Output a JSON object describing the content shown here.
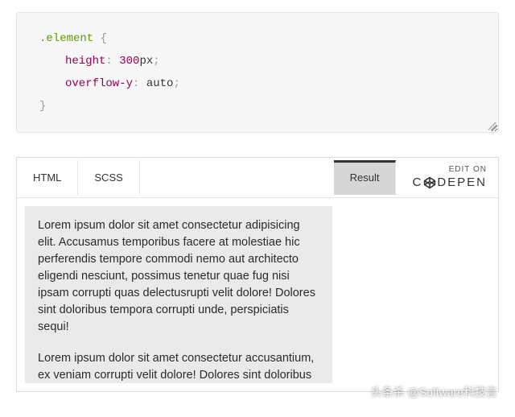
{
  "code": {
    "selector": ".element",
    "brace_open": " {",
    "brace_close": "}",
    "prop1_name": "height",
    "prop1_colon": ": ",
    "prop1_value": "300",
    "prop1_unit": "px",
    "semi": ";",
    "prop2_name": "overflow-y",
    "prop2_colon": ": ",
    "prop2_value": "auto"
  },
  "tabs": {
    "html": "HTML",
    "scss": "SCSS",
    "result": "Result"
  },
  "editon": {
    "label": "EDIT ON",
    "brand_pre": "C",
    "brand_post": "DEPEN"
  },
  "content": {
    "p1": "Lorem ipsum dolor sit amet consectetur adipisicing elit. Accusamus temporibus facere at molestiae hic perferendis tempore commodi nemo aut architecto eligendi nesciunt, possimus tenetur quae fug nisi ipsam corrupti quas delectusrupti velit dolore! Dolores sint doloribus tempora corrupti unde, perspiciatis sequi!",
    "p2": "Lorem ipsum dolor sit amet consectetur accusantium, ex veniam corrupti velit dolore! Dolores sint doloribus tempora corrupti unde."
  },
  "watermark": "头条杀 @Software科技言"
}
